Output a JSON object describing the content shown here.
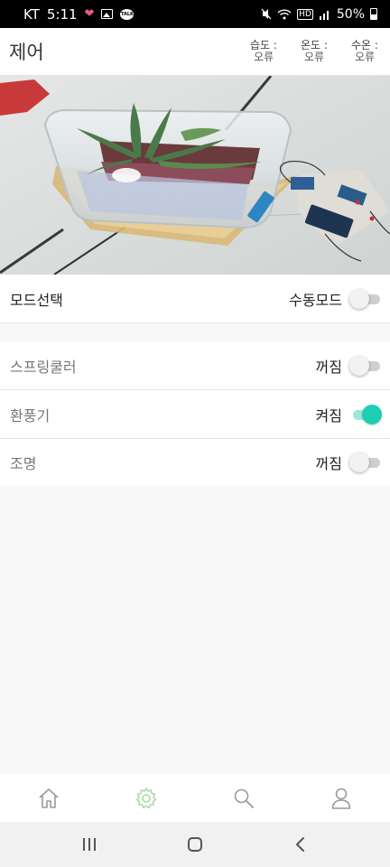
{
  "status_bar": {
    "carrier": "KT",
    "time": "5:11",
    "network": "HD",
    "battery": "50%"
  },
  "header": {
    "title": "제어",
    "stats": [
      {
        "label": "습도 :",
        "value": "오류"
      },
      {
        "label": "온도 :",
        "value": "오류"
      },
      {
        "label": "수온 :",
        "value": "오류"
      }
    ]
  },
  "controls": {
    "mode": {
      "label": "모드선택",
      "state": "수동모드",
      "on": false
    },
    "sprinkler": {
      "label": "스프링쿨러",
      "state": "꺼짐",
      "on": false
    },
    "fan": {
      "label": "환풍기",
      "state": "켜짐",
      "on": true
    },
    "light": {
      "label": "조명",
      "state": "꺼짐",
      "on": false
    }
  },
  "bottom_nav": {
    "items": [
      "home-icon",
      "settings-gear-icon",
      "search-icon",
      "profile-icon"
    ],
    "active": "settings-gear-icon",
    "active_color": "#a6d8a8",
    "inactive_color": "#9a9a9a"
  },
  "colors": {
    "toggle_on": "#1dcfb2",
    "toggle_on_track": "#9be8d9",
    "toggle_off_track": "#cfcfcf"
  }
}
